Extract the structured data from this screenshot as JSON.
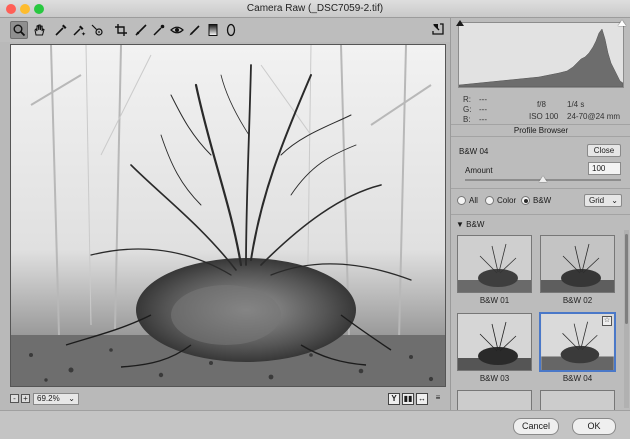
{
  "window": {
    "title": "Camera Raw (_DSC7059-2.tif)"
  },
  "toolbar": {
    "tools": [
      "zoom-icon",
      "hand-icon",
      "white-balance-icon",
      "color-sampler-icon",
      "targeted-adjustment-icon",
      "crop-icon",
      "straighten-icon",
      "spot-removal-icon",
      "red-eye-icon",
      "adjustment-brush-icon",
      "graduated-filter-icon",
      "radial-filter-icon"
    ],
    "active_tool": "zoom-icon"
  },
  "status": {
    "zoom_minus": "-",
    "zoom_plus": "+",
    "zoom_level": "69.2%",
    "view_y": "Y",
    "view_before_after": "▮▮",
    "view_swap": "↔",
    "view_settings": "≡"
  },
  "info": {
    "r_label": "R:",
    "r_value": "---",
    "g_label": "G:",
    "g_value": "---",
    "b_label": "B:",
    "b_value": "---",
    "aperture": "f/8",
    "shutter": "1/4 s",
    "iso": "ISO 100",
    "lens": "24-70@24 mm"
  },
  "profile_browser": {
    "title": "Profile Browser",
    "selected_profile": "B&W 04",
    "close_label": "Close",
    "amount_label": "Amount",
    "amount_value": "100",
    "amount_fraction": 0.5,
    "filters": {
      "all": "All",
      "color": "Color",
      "bw": "B&W",
      "selected": "bw"
    },
    "view_mode": "Grid",
    "group_name": "B&W",
    "thumbnails": [
      {
        "label": "B&W 01",
        "selected": false
      },
      {
        "label": "B&W 02",
        "selected": false
      },
      {
        "label": "B&W 03",
        "selected": false
      },
      {
        "label": "B&W 04",
        "selected": true
      }
    ]
  },
  "dialog": {
    "cancel_label": "Cancel",
    "ok_label": "OK"
  },
  "colors": {
    "selection_accent": "#4a78c8"
  }
}
